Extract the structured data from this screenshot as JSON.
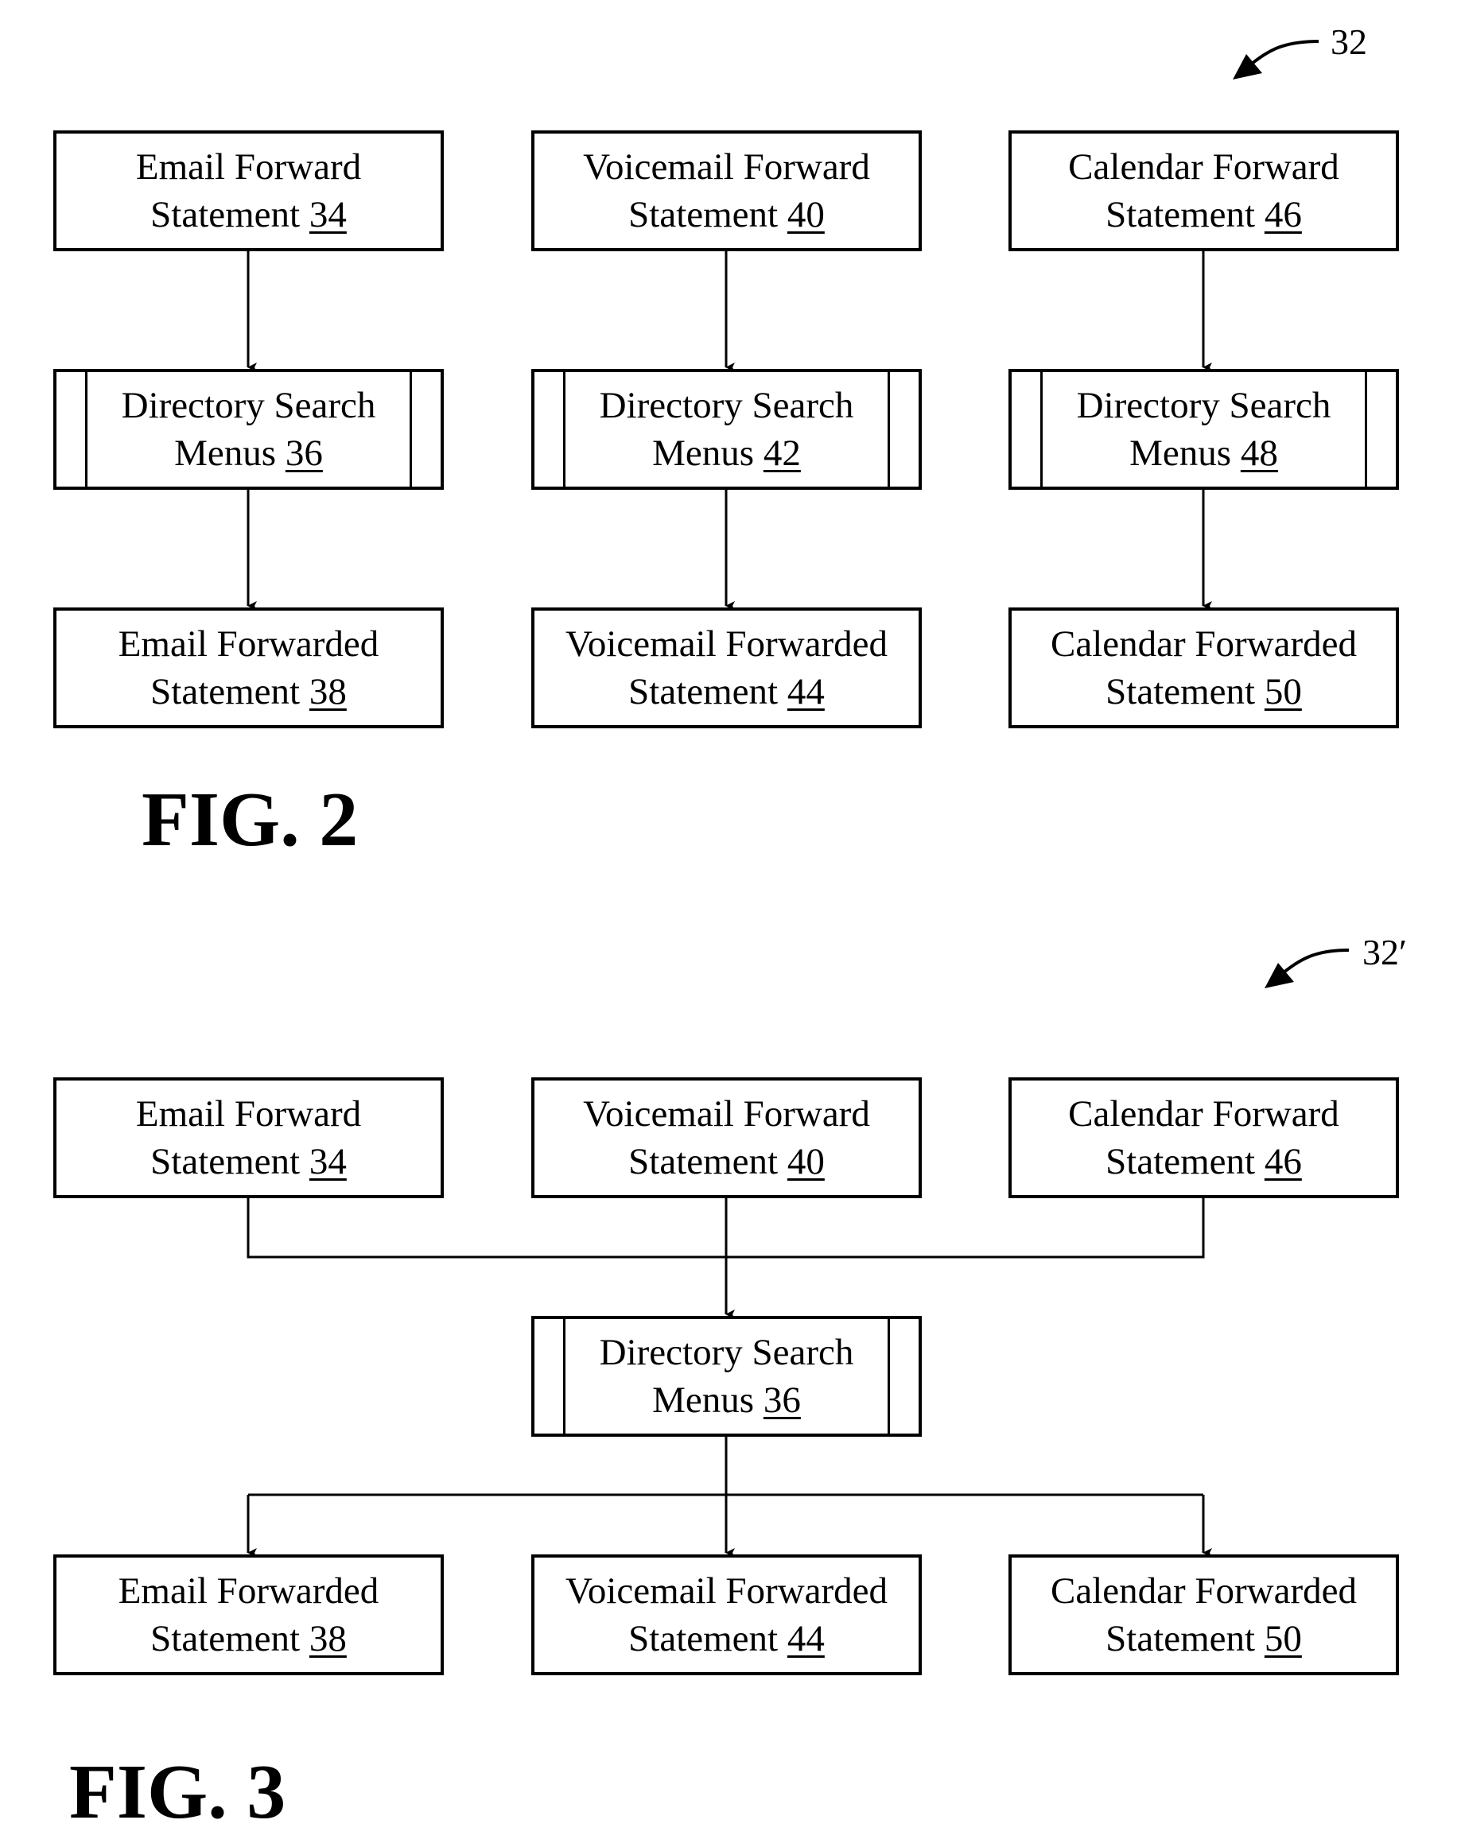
{
  "fig2": {
    "caption": "FIG. 2",
    "ref_label": "32",
    "columns": [
      {
        "forward": {
          "text": "Email Forward",
          "line2": "Statement",
          "ref": "34"
        },
        "search": {
          "text": "Directory Search",
          "line2": "Menus",
          "ref": "36"
        },
        "forwarded": {
          "text": "Email Forwarded",
          "line2": "Statement",
          "ref": "38"
        }
      },
      {
        "forward": {
          "text": "Voicemail Forward",
          "line2": "Statement",
          "ref": "40"
        },
        "search": {
          "text": "Directory Search",
          "line2": "Menus",
          "ref": "42"
        },
        "forwarded": {
          "text": "Voicemail Forwarded",
          "line2": "Statement",
          "ref": "44"
        }
      },
      {
        "forward": {
          "text": "Calendar Forward",
          "line2": "Statement",
          "ref": "46"
        },
        "search": {
          "text": "Directory Search",
          "line2": "Menus",
          "ref": "48"
        },
        "forwarded": {
          "text": "Calendar Forwarded",
          "line2": "Statement",
          "ref": "50"
        }
      }
    ]
  },
  "fig3": {
    "caption": "FIG. 3",
    "ref_label": "32′",
    "inputs": [
      {
        "text": "Email Forward",
        "line2": "Statement",
        "ref": "34"
      },
      {
        "text": "Voicemail Forward",
        "line2": "Statement",
        "ref": "40"
      },
      {
        "text": "Calendar Forward",
        "line2": "Statement",
        "ref": "46"
      }
    ],
    "search": {
      "text": "Directory Search",
      "line2": "Menus",
      "ref": "36"
    },
    "outputs": [
      {
        "text": "Email Forwarded",
        "line2": "Statement",
        "ref": "38"
      },
      {
        "text": "Voicemail Forwarded",
        "line2": "Statement",
        "ref": "44"
      },
      {
        "text": "Calendar Forwarded",
        "line2": "Statement",
        "ref": "50"
      }
    ]
  }
}
